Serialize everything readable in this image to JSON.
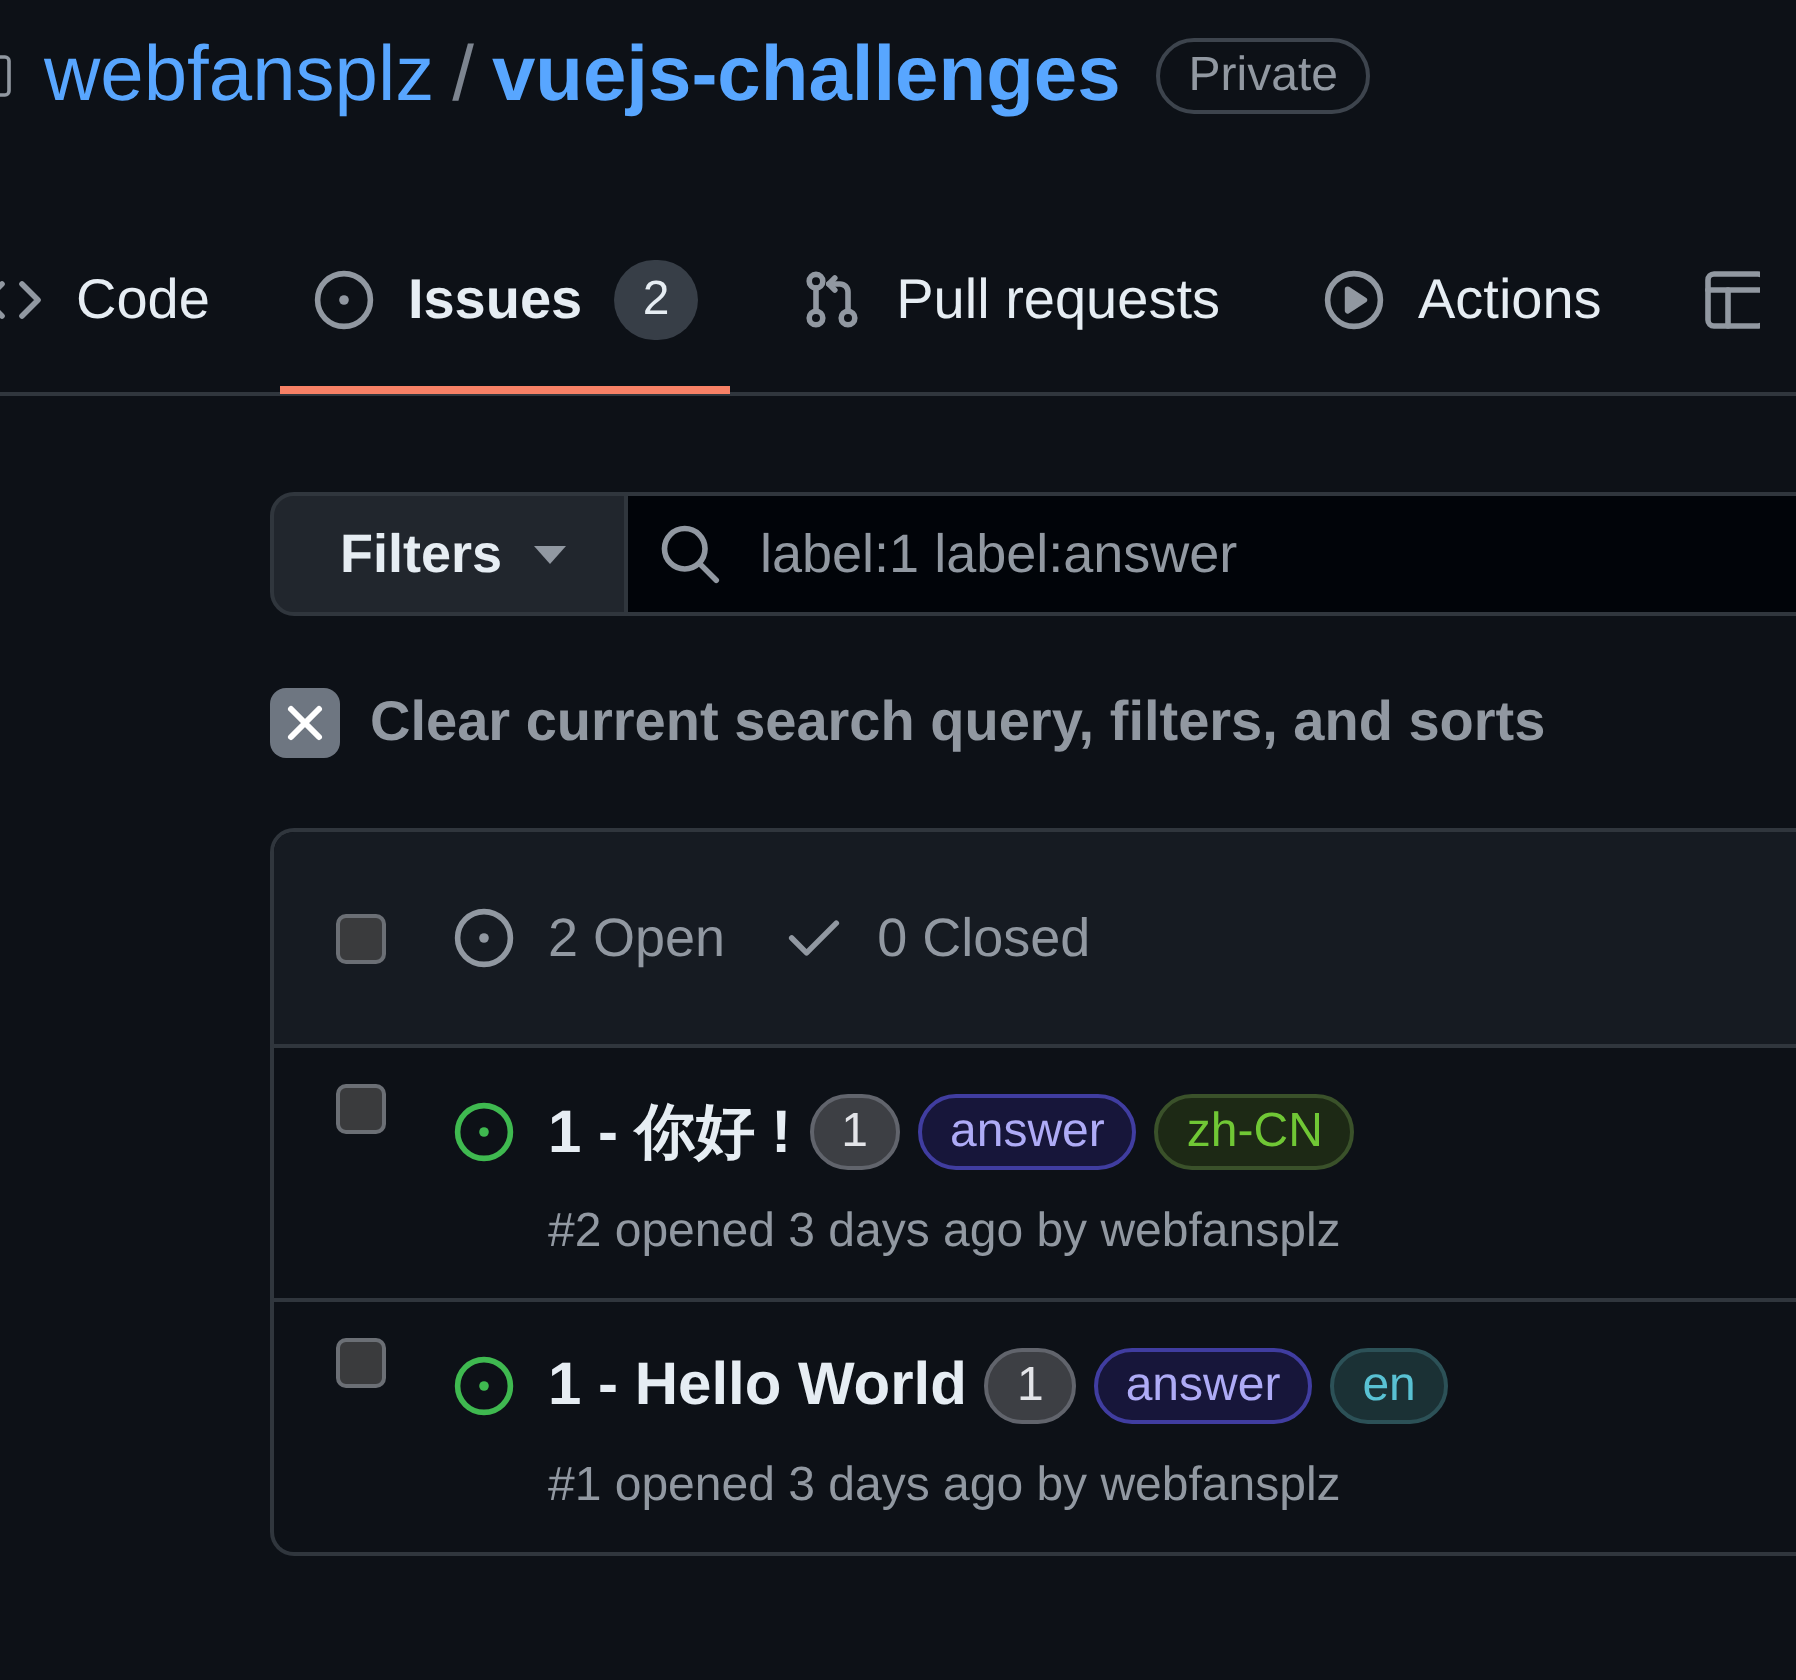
{
  "repo": {
    "owner": "webfansplz",
    "separator": "/",
    "name": "vuejs-challenges",
    "visibility": "Private"
  },
  "tabs": [
    {
      "kind": "code",
      "label": "Code",
      "selected": false
    },
    {
      "kind": "issues",
      "label": "Issues",
      "count": "2",
      "selected": true
    },
    {
      "kind": "pulls",
      "label": "Pull requests",
      "selected": false
    },
    {
      "kind": "actions",
      "label": "Actions",
      "selected": false
    },
    {
      "kind": "table",
      "selected": false
    }
  ],
  "filters": {
    "button": "Filters",
    "query": "label:1 label:answer"
  },
  "clear_filters": "Clear current search query, filters, and sorts",
  "issue_list": {
    "header": {
      "checked": false,
      "states": [
        {
          "kind": "open",
          "label": "2 Open",
          "selected": false
        },
        {
          "kind": "closed",
          "label": "0 Closed",
          "selected": false
        }
      ]
    },
    "issues": [
      {
        "kind": "open",
        "checked": false,
        "title": "1 - 你好 !",
        "labels": [
          {
            "name": "1",
            "color": "#3d3f44"
          },
          {
            "name": "answer",
            "color": "#17163a"
          },
          {
            "name": "zh-CN",
            "color": "#1d2915"
          }
        ],
        "meta": "#2 opened 3 days ago by webfansplz"
      },
      {
        "kind": "open",
        "checked": false,
        "title": "1 - Hello World",
        "labels": [
          {
            "name": "1",
            "color": "#3d3f44"
          },
          {
            "name": "answer",
            "color": "#17163a"
          },
          {
            "name": "en",
            "color": "#1b3135"
          }
        ],
        "meta": "#1 opened 3 days ago by webfansplz"
      }
    ]
  }
}
